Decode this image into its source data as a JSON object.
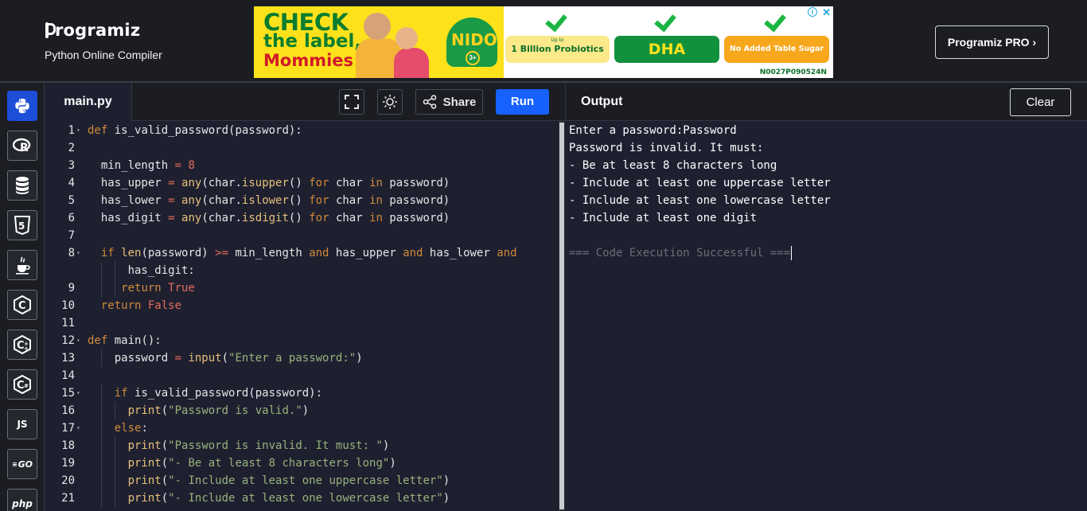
{
  "header": {
    "brand_name": "rogramiz",
    "subtitle": "Python Online Compiler",
    "pro_button": "Programiz PRO ›"
  },
  "ad": {
    "headline_line1": "CHECK",
    "headline_line2": "the label,",
    "headline_line3": "Mommies!",
    "product": "NIDO",
    "age_badge": "3+",
    "probiotics_small": "Up to",
    "probiotics": "1 Billion Probiotics",
    "dha": "DHA",
    "no_sugar": "No Added Table Sugar",
    "code": "N0027P090524N",
    "close": "✕",
    "info": "i",
    "colors": {
      "yellow": "#fde21b",
      "green": "#11913c",
      "orange": "#f7a71b"
    }
  },
  "sidebar": {
    "languages": [
      {
        "name": "python",
        "icon": "python-icon",
        "label": ""
      },
      {
        "name": "r",
        "icon": "r-icon",
        "label": "R"
      },
      {
        "name": "sql",
        "icon": "database-icon",
        "label": ""
      },
      {
        "name": "html",
        "icon": "html5-icon",
        "label": "5"
      },
      {
        "name": "java",
        "icon": "java-icon",
        "label": ""
      },
      {
        "name": "c",
        "icon": "c-icon",
        "label": "C"
      },
      {
        "name": "cpp",
        "icon": "cpp-icon",
        "label": "C"
      },
      {
        "name": "csharp",
        "icon": "csharp-icon",
        "label": "C"
      },
      {
        "name": "javascript",
        "icon": "js-icon",
        "label": "JS"
      },
      {
        "name": "go",
        "icon": "go-icon",
        "label": "GO"
      },
      {
        "name": "php",
        "icon": "php-icon",
        "label": "php"
      }
    ]
  },
  "editor": {
    "filename": "main.py",
    "share_label": "Share",
    "run_label": "Run",
    "lines": [
      {
        "n": "1",
        "fold": true,
        "text": "def is_valid_password(password):"
      },
      {
        "n": "2",
        "fold": false,
        "text": ""
      },
      {
        "n": "3",
        "fold": false,
        "text": "  min_length = 8"
      },
      {
        "n": "4",
        "fold": false,
        "text": "  has_upper = any(char.isupper() for char in password)"
      },
      {
        "n": "5",
        "fold": false,
        "text": "  has_lower = any(char.islower() for char in password)"
      },
      {
        "n": "6",
        "fold": false,
        "text": "  has_digit = any(char.isdigit() for char in password)"
      },
      {
        "n": "7",
        "fold": false,
        "text": ""
      },
      {
        "n": "8",
        "fold": true,
        "text": "  if len(password) >= min_length and has_upper and has_lower and"
      },
      {
        "n": "",
        "fold": false,
        "text": "      has_digit:"
      },
      {
        "n": "9",
        "fold": false,
        "text": "     return True"
      },
      {
        "n": "10",
        "fold": false,
        "text": "  return False"
      },
      {
        "n": "11",
        "fold": false,
        "text": ""
      },
      {
        "n": "12",
        "fold": true,
        "text": "def main():"
      },
      {
        "n": "13",
        "fold": false,
        "text": "    password = input(\"Enter a password:\")"
      },
      {
        "n": "14",
        "fold": false,
        "text": ""
      },
      {
        "n": "15",
        "fold": true,
        "text": "    if is_valid_password(password):"
      },
      {
        "n": "16",
        "fold": false,
        "text": "      print(\"Password is valid.\")"
      },
      {
        "n": "17",
        "fold": true,
        "text": "    else:"
      },
      {
        "n": "18",
        "fold": false,
        "text": "      print(\"Password is invalid. It must: \")"
      },
      {
        "n": "19",
        "fold": false,
        "text": "      print(\"- Be at least 8 characters long\")"
      },
      {
        "n": "20",
        "fold": false,
        "text": "      print(\"- Include at least one uppercase letter\")"
      },
      {
        "n": "21",
        "fold": false,
        "text": "      print(\"- Include at least one lowercase letter\")"
      }
    ]
  },
  "output": {
    "title": "Output",
    "clear_label": "Clear",
    "lines": [
      "Enter a password:Password",
      "Password is invalid. It must:",
      "- Be at least 8 characters long",
      "- Include at least one uppercase letter",
      "- Include at least one lowercase letter",
      "- Include at least one digit",
      "",
      "=== Code Execution Successful ==="
    ]
  }
}
